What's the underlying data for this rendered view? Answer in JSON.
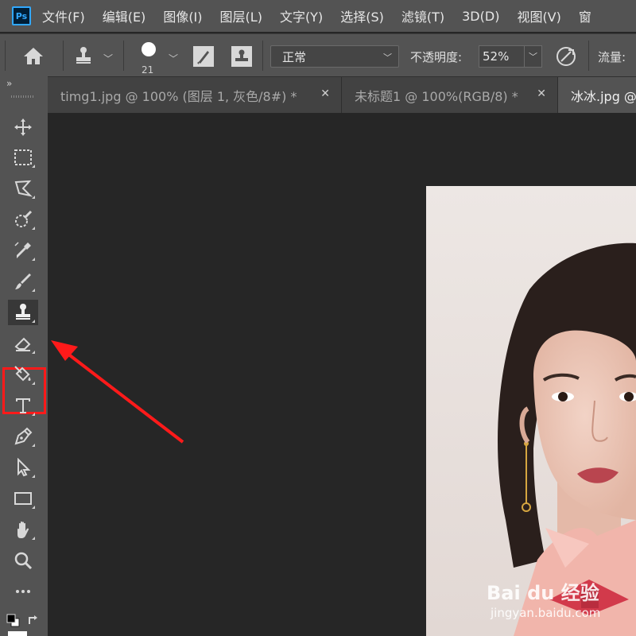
{
  "app": {
    "logo_text": "Ps"
  },
  "menu": [
    "文件(F)",
    "编辑(E)",
    "图像(I)",
    "图层(L)",
    "文字(Y)",
    "选择(S)",
    "滤镜(T)",
    "3D(D)",
    "视图(V)",
    "窗"
  ],
  "options": {
    "brush_size": "21",
    "mode_value": "正常",
    "opacity_label": "不透明度:",
    "opacity_value": "52%",
    "flow_label": "流量:"
  },
  "toolbar": {
    "collapse_glyph": "»",
    "selected_tool": "clone-stamp-tool",
    "tools": [
      "move-tool",
      "rectangular-marquee-tool",
      "lasso-tool",
      "quick-selection-tool",
      "eyedropper-tool",
      "brush-tool",
      "clone-stamp-tool",
      "eraser-tool",
      "paint-bucket-tool",
      "type-tool",
      "pen-tool",
      "path-selection-tool",
      "rectangle-tool",
      "hand-tool",
      "zoom-tool",
      "more-tools",
      "default-colors",
      "swap-colors"
    ]
  },
  "tabs": [
    {
      "label": "timg1.jpg @ 100% (图层 1, 灰色/8#) *",
      "active": false
    },
    {
      "label": "未标题1 @ 100%(RGB/8) *",
      "active": false
    },
    {
      "label": "冰冰.jpg @",
      "active": true
    }
  ],
  "watermark": {
    "brand": "Bai du 经验",
    "url": "jingyan.baidu.com"
  },
  "colors": {
    "highlight": "#ff1a1a",
    "ps_blue": "#31a8ff"
  }
}
